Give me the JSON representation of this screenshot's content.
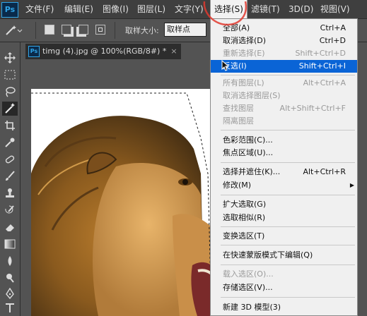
{
  "menubar": {
    "logo": "Ps",
    "items": [
      {
        "label": "文件(F)"
      },
      {
        "label": "编辑(E)"
      },
      {
        "label": "图像(I)"
      },
      {
        "label": "图层(L)"
      },
      {
        "label": "文字(Y)"
      },
      {
        "label": "选择(S)"
      },
      {
        "label": "滤镜(T)"
      },
      {
        "label": "3D(D)"
      },
      {
        "label": "视图(V)"
      }
    ]
  },
  "options": {
    "sample_size_label": "取样大小:",
    "sample_size_value": "取样点"
  },
  "document": {
    "tab_title": "timg (4).jpg @ 100%(RGB/8#) *",
    "close_glyph": "×"
  },
  "select_menu": {
    "items": [
      {
        "label": "全部(A)",
        "shortcut": "Ctrl+A"
      },
      {
        "label": "取消选择(D)",
        "shortcut": "Ctrl+D"
      },
      {
        "label": "重新选择(E)",
        "shortcut": "Shift+Ctrl+D"
      },
      {
        "label": "反选(I)",
        "shortcut": "Shift+Ctrl+I"
      },
      {
        "label": "所有图层(L)",
        "shortcut": "Alt+Ctrl+A"
      },
      {
        "label": "取消选择图层(S)",
        "shortcut": ""
      },
      {
        "label": "查找图层",
        "shortcut": "Alt+Shift+Ctrl+F"
      },
      {
        "label": "隔离图层",
        "shortcut": ""
      },
      {
        "label": "色彩范围(C)...",
        "shortcut": ""
      },
      {
        "label": "焦点区域(U)...",
        "shortcut": ""
      },
      {
        "label": "选择并遮住(K)...",
        "shortcut": "Alt+Ctrl+R"
      },
      {
        "label": "修改(M)",
        "shortcut": ""
      },
      {
        "label": "扩大选取(G)",
        "shortcut": ""
      },
      {
        "label": "选取相似(R)",
        "shortcut": ""
      },
      {
        "label": "变换选区(T)",
        "shortcut": ""
      },
      {
        "label": "在快速蒙版模式下编辑(Q)",
        "shortcut": ""
      },
      {
        "label": "载入选区(O)...",
        "shortcut": ""
      },
      {
        "label": "存储选区(V)...",
        "shortcut": ""
      },
      {
        "label": "新建 3D 模型(3)",
        "shortcut": ""
      }
    ]
  },
  "colors": {
    "highlight": "#0a64d6",
    "menubar_bg": "#3f3f3f",
    "panel_bg": "#535353",
    "annotation": "#e03a2f"
  }
}
